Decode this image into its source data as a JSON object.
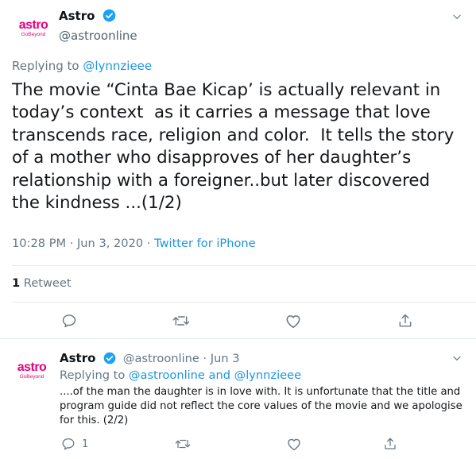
{
  "main_tweet": {
    "avatar": {
      "brand": "astro",
      "tagline": "GoBeyond"
    },
    "display_name": "Astro",
    "handle": "@astroonline",
    "replying_prefix": "Replying to",
    "replying_to": "@lynnzieee",
    "text": "The movie “Cinta Bae Kicap’ is actually relevant in today’s context  as it carries a message that love transcends race, religion and color.  It tells the story of a mother who disapproves of her daughter’s relationship with a foreigner..but later discovered the kindness ...(1/2)",
    "time": "10:28 PM · Jun 3, 2020 · ",
    "source": "Twitter for iPhone",
    "retweet_count": "1",
    "retweet_label": "Retweet",
    "icons": [
      "reply-icon",
      "retweet-icon",
      "like-icon",
      "share-icon",
      "chevron-down-icon",
      "verified-icon"
    ]
  },
  "reply_tweet": {
    "avatar": {
      "brand": "astro",
      "tagline": "GoBeyond"
    },
    "display_name": "Astro",
    "handle_date": "@astroonline · Jun 3",
    "replying_prefix": "Replying to",
    "replying_to": "@astroonline and @lynnzieee",
    "text": "....of the man the daughter is in love with. It is unfortunate that the title and program guide did not reflect the core values of the movie and we apologise for this. (2/2)",
    "reply_count": "1"
  },
  "colors": {
    "brand": "#e6007e",
    "link": "#1b95e0",
    "muted": "#657786",
    "verified": "#1da1f2"
  }
}
